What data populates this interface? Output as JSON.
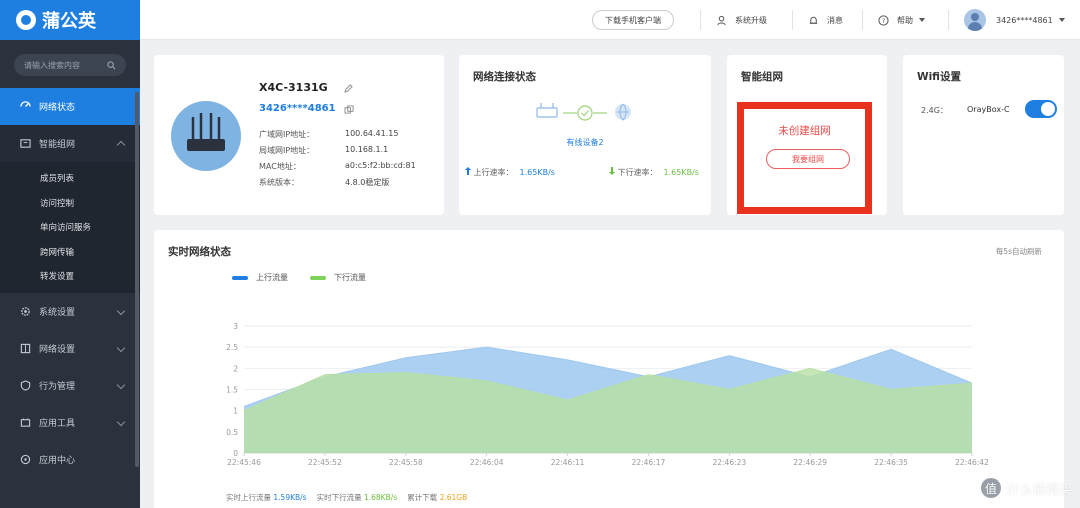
{
  "brand": {
    "name": "蒲公英"
  },
  "sidebar": {
    "search_placeholder": "请输入搜索内容",
    "items": [
      {
        "label": "网络状态",
        "active": true
      },
      {
        "label": "智能组网",
        "open": true
      },
      {
        "label": "系统设置"
      },
      {
        "label": "网络设置"
      },
      {
        "label": "行为管理"
      },
      {
        "label": "应用工具"
      },
      {
        "label": "应用中心"
      }
    ],
    "subitems": [
      "成员列表",
      "访问控制",
      "单向访问服务",
      "跨网传输",
      "转发设置"
    ]
  },
  "topbar": {
    "download_btn": "下载手机客户端",
    "upgrade": "系统升级",
    "notice": "消息",
    "help": "帮助",
    "user": "3426****4861"
  },
  "device": {
    "name": "X4C-3131G",
    "id": "3426****4861",
    "rows": [
      {
        "label": "广域网IP地址：",
        "value": "100.64.41.15"
      },
      {
        "label": "局域网IP地址：",
        "value": "10.168.1.1"
      },
      {
        "label": "MAC地址：",
        "value": "a0:c5:f2:bb:cd:81"
      },
      {
        "label": "系统版本：",
        "value": "4.8.0稳定版"
      }
    ]
  },
  "network": {
    "title": "网络连接状态",
    "link": "有线设备2",
    "up_label": "上行速率：",
    "up_value": "1.65KB/s",
    "down_label": "下行速率：",
    "down_value": "1.65KB/s"
  },
  "mesh": {
    "title": "智能组网",
    "status": "未创建组网",
    "button": "我要组网"
  },
  "wifi": {
    "title": "Wifi设置",
    "band": "2.4G：",
    "ssid": "OrayBox-C",
    "enabled": true
  },
  "realtime": {
    "title": "实时网络状态",
    "note": "每5s自动刷新",
    "stats": {
      "up_label": "实时上行流量",
      "up_value": "1.59KB/s",
      "down_label": "实时下行流量",
      "down_value": "1.68KB/s",
      "total_label": "累计下载",
      "total_value": "2.61GB"
    }
  },
  "chart_data": {
    "type": "area",
    "categories": [
      "22:45:46",
      "22:45:52",
      "22:45:58",
      "22:46:04",
      "22:46:11",
      "22:46:17",
      "22:46:23",
      "22:46:29",
      "22:46:35",
      "22:46:42"
    ],
    "ylim": [
      0,
      3
    ],
    "yticks": [
      0,
      0.5,
      1,
      1.5,
      2,
      2.5,
      3
    ],
    "series": [
      {
        "name": "上行流量",
        "color": "#1e7fe0",
        "values": [
          1.1,
          1.8,
          2.25,
          2.5,
          2.2,
          1.8,
          2.3,
          1.8,
          2.45,
          1.65
        ]
      },
      {
        "name": "下行流量",
        "color": "#7dd35a",
        "values": [
          1.0,
          1.85,
          1.9,
          1.7,
          1.25,
          1.85,
          1.5,
          2.0,
          1.5,
          1.65
        ]
      }
    ]
  },
  "watermark": "什么值得买"
}
